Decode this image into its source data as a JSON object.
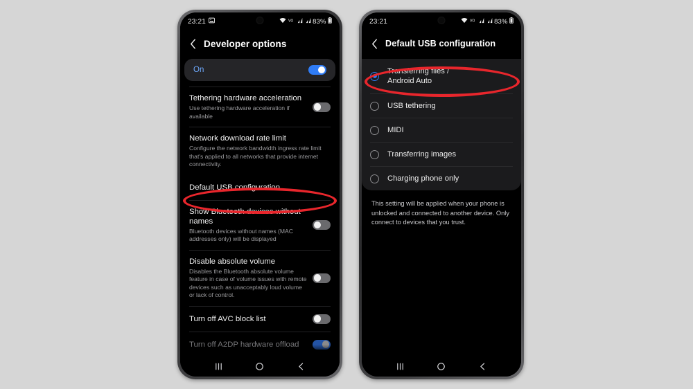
{
  "meta": {
    "background_color": "#d6d6d6",
    "accent_blue": "#2f7cf6",
    "annotation_red": "#e8262c"
  },
  "left_phone": {
    "status_bar": {
      "time": "23:21",
      "battery_percent": "83%",
      "icons": [
        "image-icon",
        "wifi-icon",
        "volte-icon",
        "signal-bars-icon",
        "signal-bars-icon",
        "battery-icon"
      ]
    },
    "header": {
      "back_icon": "chevron-left-icon",
      "title": "Developer options"
    },
    "master_switch": {
      "label": "On",
      "state": "on"
    },
    "settings": [
      {
        "title": "Tethering hardware acceleration",
        "subtitle": "Use tethering hardware acceleration if available",
        "control": "toggle",
        "state": "off"
      },
      {
        "title": "Network download rate limit",
        "subtitle": "Configure the network bandwidth ingress rate limit that's applied to all networks that provide internet connectivity.",
        "control": "none",
        "state": ""
      },
      {
        "title": "Default USB configuration",
        "subtitle": "",
        "control": "none",
        "state": "",
        "highlighted": true
      },
      {
        "title": "Show Bluetooth devices without names",
        "subtitle": "Bluetooth devices without names (MAC addresses only) will be displayed",
        "control": "toggle",
        "state": "off"
      },
      {
        "title": "Disable absolute volume",
        "subtitle": "Disables the Bluetooth absolute volume feature in case of volume issues with remote devices such as unacceptably loud volume or lack of control.",
        "control": "toggle",
        "state": "off"
      },
      {
        "title": "Turn off AVC block list",
        "subtitle": "",
        "control": "toggle",
        "state": "off"
      },
      {
        "title": "Turn off A2DP hardware offload",
        "subtitle": "",
        "control": "toggle",
        "state": "on"
      }
    ],
    "nav_bar": [
      "recents-icon",
      "home-icon",
      "back-icon"
    ]
  },
  "right_phone": {
    "status_bar": {
      "time": "23:21",
      "battery_percent": "83%",
      "icons": [
        "wifi-icon",
        "volte-icon",
        "signal-bars-icon",
        "signal-bars-icon",
        "battery-icon"
      ]
    },
    "header": {
      "back_icon": "chevron-left-icon",
      "title": "Default USB configuration"
    },
    "options": [
      {
        "label": "Transferring files / Android Auto",
        "selected": true,
        "highlighted": true
      },
      {
        "label": "USB tethering",
        "selected": false
      },
      {
        "label": "MIDI",
        "selected": false
      },
      {
        "label": "Transferring images",
        "selected": false
      },
      {
        "label": "Charging phone only",
        "selected": false
      }
    ],
    "footnote": "This setting will be applied when your phone is unlocked and connected to another device. Only connect to devices that you trust.",
    "nav_bar": [
      "recents-icon",
      "home-icon",
      "back-icon"
    ]
  }
}
